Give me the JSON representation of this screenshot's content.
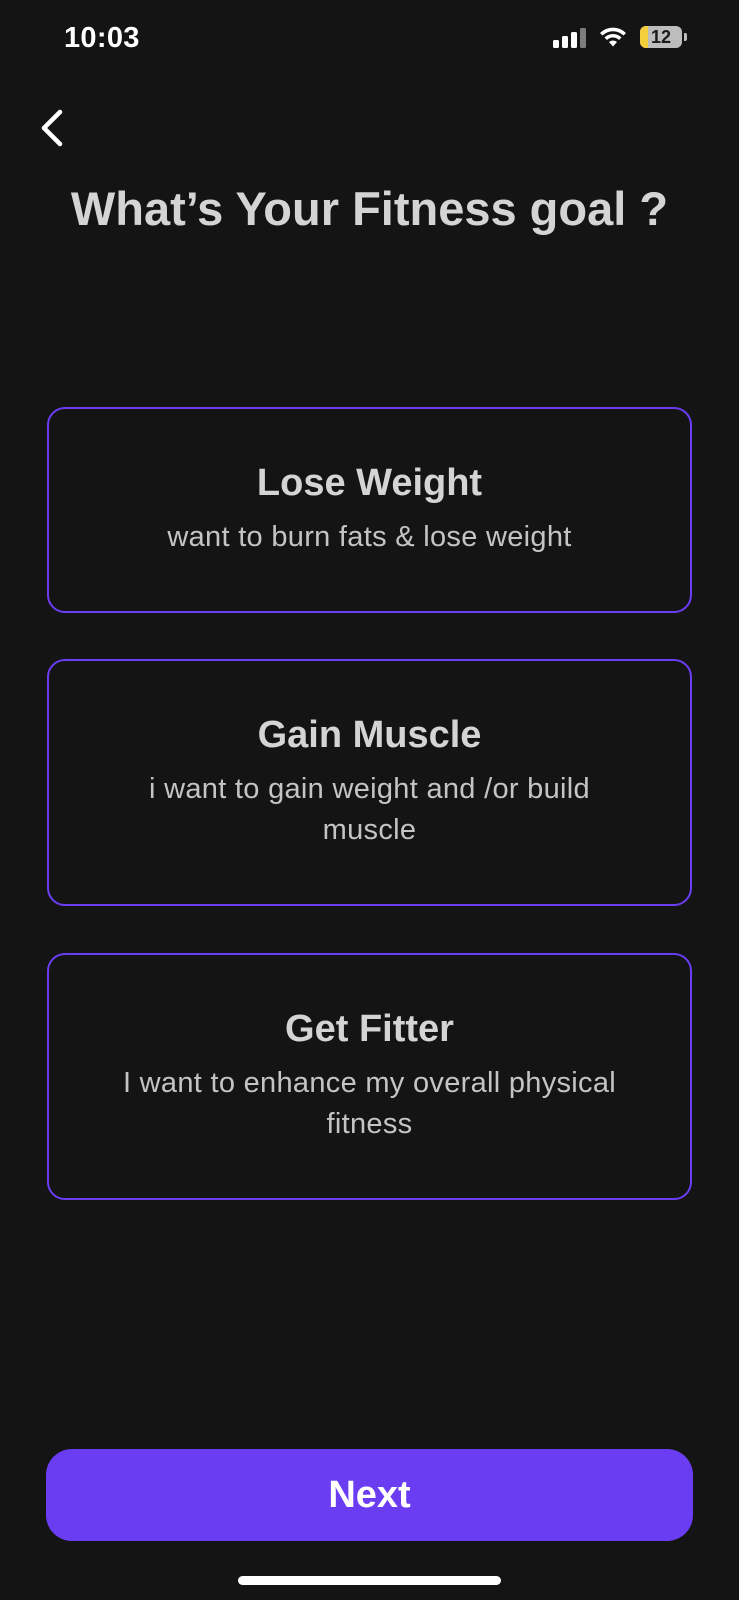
{
  "status_bar": {
    "time": "10:03",
    "battery_level": "12",
    "icons": [
      "cellular-signal-icon",
      "wifi-icon",
      "battery-icon"
    ]
  },
  "header": {
    "back_icon": "chevron-left-icon",
    "title": "What’s Your Fitness goal ?"
  },
  "goals": [
    {
      "title": "Lose Weight",
      "description": "want to burn fats & lose weight"
    },
    {
      "title": "Gain Muscle",
      "description": "i want to gain weight and /or build muscle"
    },
    {
      "title": "Get Fitter",
      "description": "I want to enhance my overall physical fitness"
    }
  ],
  "footer": {
    "next_label": "Next"
  },
  "colors": {
    "background": "#141414",
    "accent": "#6a3df3",
    "text": "#d4d4d4",
    "battery_low": "#f4cf3c"
  }
}
